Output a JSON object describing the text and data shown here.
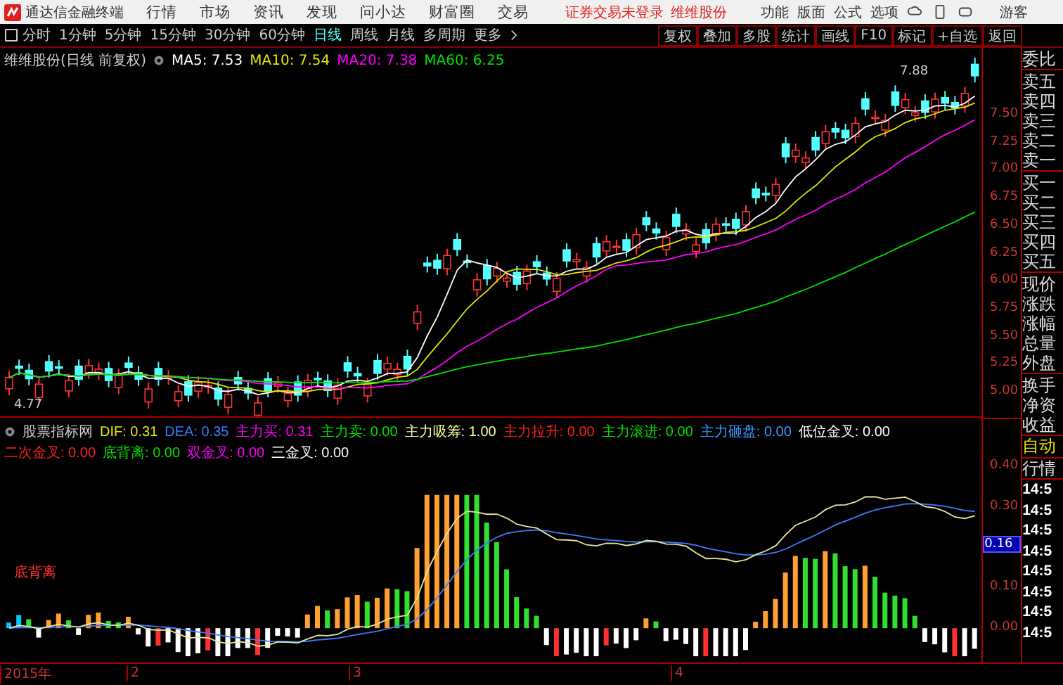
{
  "menu_bar": {
    "app_title": "通达信金融终端",
    "menus": [
      "行情",
      "市场",
      "资讯",
      "发现",
      "问小达",
      "财富圈",
      "交易"
    ],
    "notice": "证券交易未登录",
    "stock_name": "维维股份",
    "tools": [
      "功能",
      "版面",
      "公式",
      "选项"
    ],
    "user": "游客"
  },
  "period_bar": {
    "periods": [
      {
        "label": "分时",
        "selected": false
      },
      {
        "label": "1分钟",
        "selected": false
      },
      {
        "label": "5分钟",
        "selected": false
      },
      {
        "label": "15分钟",
        "selected": false
      },
      {
        "label": "30分钟",
        "selected": false
      },
      {
        "label": "60分钟",
        "selected": false
      },
      {
        "label": "日线",
        "selected": true
      },
      {
        "label": "周线",
        "selected": false
      },
      {
        "label": "月线",
        "selected": false
      },
      {
        "label": "多周期",
        "selected": false
      },
      {
        "label": "更多",
        "selected": false
      }
    ],
    "buttons": [
      "复权",
      "叠加",
      "多股",
      "统计",
      "画线",
      "F10",
      "标记",
      "+自选",
      "返回"
    ]
  },
  "main_chart": {
    "title": "维维股份(日线 前复权)",
    "ma": [
      {
        "label": "MA5: 7.53",
        "color": "#ffffff"
      },
      {
        "label": "MA10: 7.54",
        "color": "#e6e600"
      },
      {
        "label": "MA20: 7.38",
        "color": "#ff00ff"
      },
      {
        "label": "MA60: 6.25",
        "color": "#00e000"
      }
    ],
    "high_label": "7.88",
    "low_label": "4.77",
    "yticks": [
      "7.50",
      "7.25",
      "7.00",
      "6.75",
      "6.50",
      "6.25",
      "6.00",
      "5.75",
      "5.50",
      "5.25",
      "5.00"
    ]
  },
  "indicator": {
    "title": "股票指标网",
    "values": [
      {
        "label": "DIF: 0.31",
        "color": "#e6e600"
      },
      {
        "label": "DEA: 0.35",
        "color": "#3b7cff"
      },
      {
        "label": "主力买: 0.31",
        "color": "#ff00ff"
      },
      {
        "label": "主力卖: 0.00",
        "color": "#00e000"
      },
      {
        "label": "主力吸筹: 1.00",
        "color": "#ffffa0"
      },
      {
        "label": "主力拉升: 0.00",
        "color": "#ff2020"
      },
      {
        "label": "主力滚进: 0.00",
        "color": "#00e000"
      },
      {
        "label": "主力砸盘: 0.00",
        "color": "#3b9cff"
      },
      {
        "label": "低位金叉: 0.00",
        "color": "#ffffff"
      },
      {
        "label": "二次金叉: 0.00",
        "color": "#ff2020"
      },
      {
        "label": "底背离: 0.00",
        "color": "#00e000"
      },
      {
        "label": "双金叉: 0.00",
        "color": "#ff00ff"
      },
      {
        "label": "三金叉: 0.00",
        "color": "#ffffff"
      }
    ],
    "annotation": "底背离",
    "yticks": [
      "0.40",
      "0.30",
      "0.10",
      "0.00"
    ],
    "current": "0.16"
  },
  "time_axis": [
    "2015年",
    "2",
    "3",
    "4"
  ],
  "side_panel": {
    "quote_groups": [
      [
        "委比"
      ],
      [
        "卖五",
        "卖四",
        "卖三",
        "卖二",
        "卖一"
      ],
      [
        "买一",
        "买二",
        "买三",
        "买四",
        "买五"
      ],
      [
        "现价",
        "涨跌",
        "涨幅",
        "总量",
        "外盘"
      ],
      [
        "换手",
        "净资",
        "收益"
      ]
    ],
    "mode_tab": "自动",
    "market_label": "行情",
    "times": [
      "14:5",
      "14:5",
      "14:5",
      "14:5",
      "14:5",
      "14:5",
      "14:5",
      "14:5"
    ]
  }
}
